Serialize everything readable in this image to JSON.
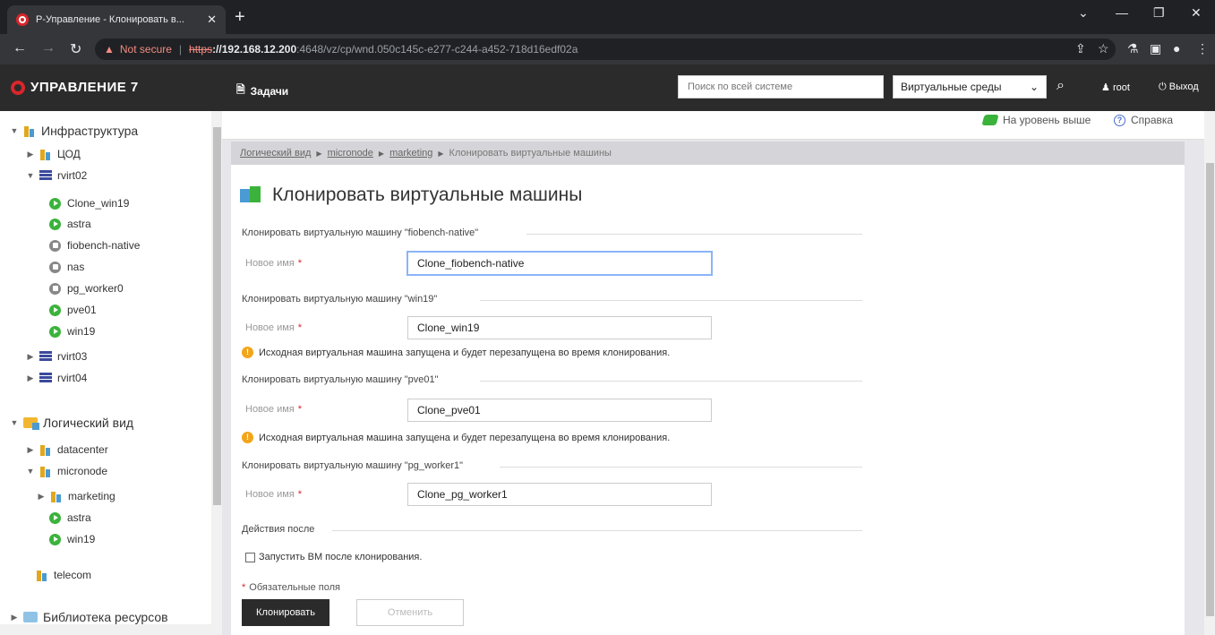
{
  "browser": {
    "tab_title": "Р-Управление - Клонировать в...",
    "address": {
      "warning_label": "Not secure",
      "protocol": "https",
      "host": "://192.168.12.200",
      "path": ":4648/vz/cp/wnd.050c145c-e277-c244-a452-718d16edf02a"
    }
  },
  "header": {
    "logo": "УПРАВЛЕНИЕ 7",
    "tasks": "Задачи",
    "search_placeholder": "Поиск по всей системе",
    "env_select": "Виртуальные среды",
    "user": "root",
    "logout": "Выход"
  },
  "sidebar": {
    "infra": "Инфраструктура",
    "tsod": "ЦОД",
    "rvirt02": "rvirt02",
    "vms": [
      {
        "label": "Clone_win19",
        "state": "running"
      },
      {
        "label": "astra",
        "state": "running"
      },
      {
        "label": "fiobench-native",
        "state": "stopped"
      },
      {
        "label": "nas",
        "state": "stopped"
      },
      {
        "label": "pg_worker0",
        "state": "stopped"
      },
      {
        "label": "pve01",
        "state": "running"
      },
      {
        "label": "win19",
        "state": "running"
      }
    ],
    "rvirt03": "rvirt03",
    "rvirt04": "rvirt04",
    "logical": "Логический вид",
    "datacenter": "datacenter",
    "micronode": "micronode",
    "marketing": "marketing",
    "mn_astra": "astra",
    "mn_win19": "win19",
    "telecom": "telecom",
    "library": "Библиотека ресурсов"
  },
  "topbar": {
    "up_level": "На уровень выше",
    "help": "Справка"
  },
  "breadcrumb": {
    "item1": "Логический вид",
    "item2": "micronode",
    "item3": "marketing",
    "current": "Клонировать виртуальные машины"
  },
  "page": {
    "title": "Клонировать виртуальные машины",
    "new_name_label": "Новое имя",
    "required_star": "*",
    "sections": [
      {
        "label": "Клонировать виртуальную машину \"fiobench-native\"",
        "value": "Clone_fiobench-native",
        "warning": ""
      },
      {
        "label": "Клонировать виртуальную машину \"win19\"",
        "value": "Clone_win19",
        "warning": "Исходная виртуальная машина запущена и будет перезапущена во время клонирования."
      },
      {
        "label": "Клонировать виртуальную машину \"pve01\"",
        "value": "Clone_pve01",
        "warning": "Исходная виртуальная машина запущена и будет перезапущена во время клонирования."
      },
      {
        "label": "Клонировать виртуальную машину \"pg_worker1\"",
        "value": "Clone_pg_worker1",
        "warning": ""
      }
    ],
    "after_actions": "Действия после",
    "start_vm_checkbox": "Запустить ВМ после клонирования.",
    "required_note": "Обязательные поля",
    "clone_button": "Клонировать",
    "cancel_button": "Отменить"
  }
}
